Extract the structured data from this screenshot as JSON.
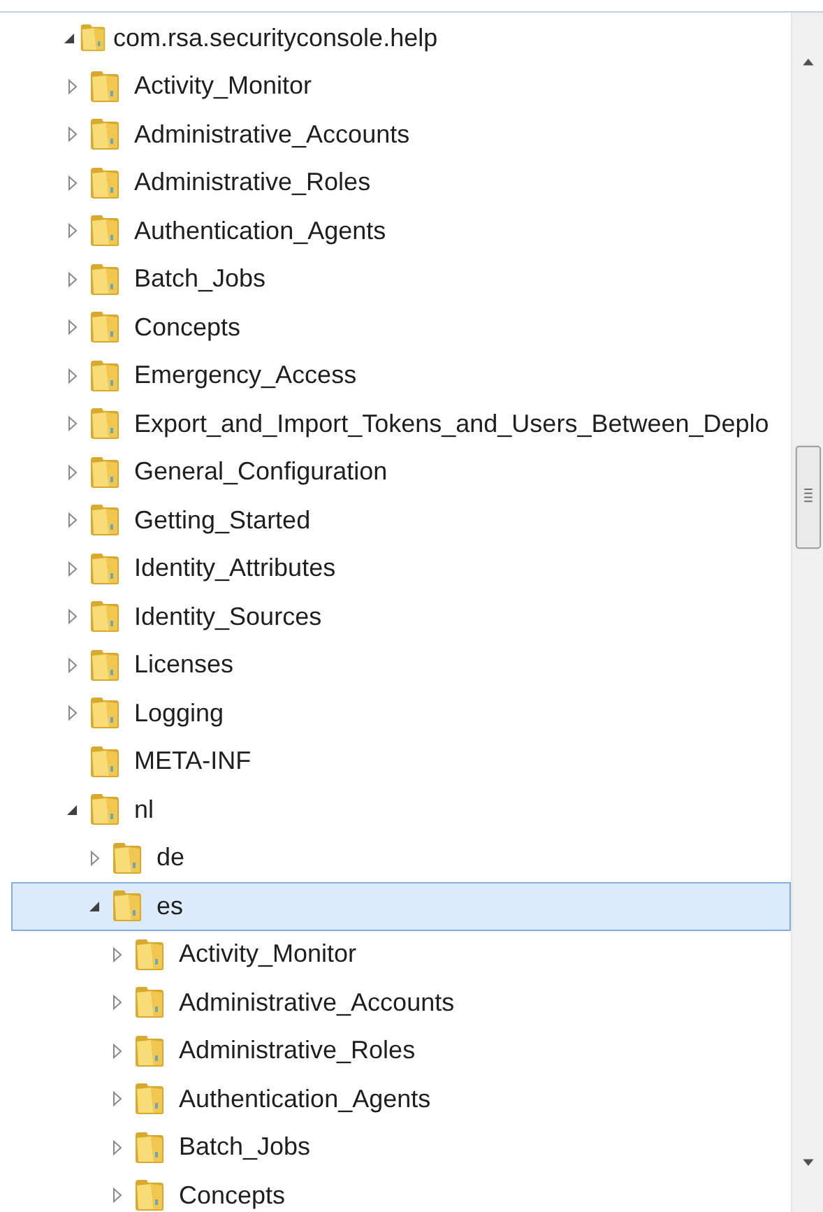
{
  "tree": [
    {
      "label": "com.rsa.securityconsole.help",
      "kind": "branch",
      "expanded": true,
      "selected": false,
      "children": [
        {
          "label": "Activity_Monitor",
          "kind": "branch",
          "expanded": false,
          "selected": false
        },
        {
          "label": "Administrative_Accounts",
          "kind": "branch",
          "expanded": false,
          "selected": false
        },
        {
          "label": "Administrative_Roles",
          "kind": "branch",
          "expanded": false,
          "selected": false
        },
        {
          "label": "Authentication_Agents",
          "kind": "branch",
          "expanded": false,
          "selected": false
        },
        {
          "label": "Batch_Jobs",
          "kind": "branch",
          "expanded": false,
          "selected": false
        },
        {
          "label": "Concepts",
          "kind": "branch",
          "expanded": false,
          "selected": false
        },
        {
          "label": "Emergency_Access",
          "kind": "branch",
          "expanded": false,
          "selected": false
        },
        {
          "label": "Export_and_Import_Tokens_and_Users_Between_Deplo",
          "kind": "branch",
          "expanded": false,
          "selected": false
        },
        {
          "label": "General_Configuration",
          "kind": "branch",
          "expanded": false,
          "selected": false
        },
        {
          "label": "Getting_Started",
          "kind": "branch",
          "expanded": false,
          "selected": false
        },
        {
          "label": "Identity_Attributes",
          "kind": "branch",
          "expanded": false,
          "selected": false
        },
        {
          "label": "Identity_Sources",
          "kind": "branch",
          "expanded": false,
          "selected": false
        },
        {
          "label": "Licenses",
          "kind": "branch",
          "expanded": false,
          "selected": false
        },
        {
          "label": "Logging",
          "kind": "branch",
          "expanded": false,
          "selected": false
        },
        {
          "label": "META-INF",
          "kind": "leaf",
          "selected": false
        },
        {
          "label": "nl",
          "kind": "branch",
          "expanded": true,
          "selected": false,
          "children": [
            {
              "label": "de",
              "kind": "branch",
              "expanded": false,
              "selected": false
            },
            {
              "label": "es",
              "kind": "branch",
              "expanded": true,
              "selected": true,
              "children": [
                {
                  "label": "Activity_Monitor",
                  "kind": "branch",
                  "expanded": false,
                  "selected": false
                },
                {
                  "label": "Administrative_Accounts",
                  "kind": "branch",
                  "expanded": false,
                  "selected": false
                },
                {
                  "label": "Administrative_Roles",
                  "kind": "branch",
                  "expanded": false,
                  "selected": false
                },
                {
                  "label": "Authentication_Agents",
                  "kind": "branch",
                  "expanded": false,
                  "selected": false
                },
                {
                  "label": "Batch_Jobs",
                  "kind": "branch",
                  "expanded": false,
                  "selected": false
                },
                {
                  "label": "Concepts",
                  "kind": "branch",
                  "expanded": false,
                  "selected": false
                }
              ]
            }
          ]
        }
      ]
    }
  ]
}
